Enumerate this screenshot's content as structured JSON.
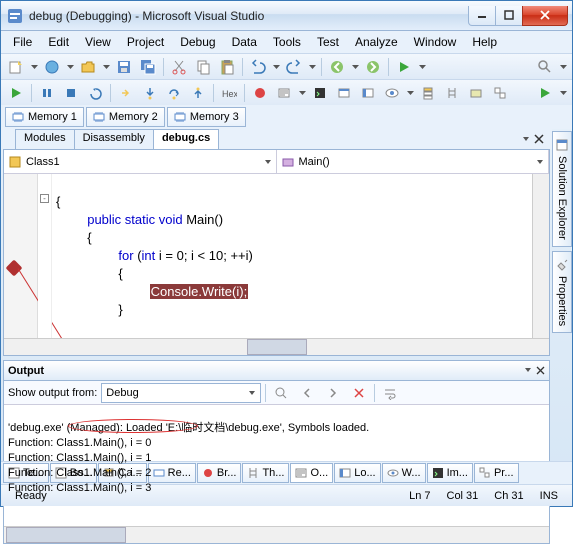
{
  "window": {
    "title": "debug (Debugging) - Microsoft Visual Studio"
  },
  "menu": [
    "File",
    "Edit",
    "View",
    "Project",
    "Debug",
    "Data",
    "Tools",
    "Test",
    "Analyze",
    "Window",
    "Help"
  ],
  "memory_tabs": [
    "Memory 1",
    "Memory 2",
    "Memory 3"
  ],
  "doc_tabs": [
    {
      "label": "Modules",
      "active": false
    },
    {
      "label": "Disassembly",
      "active": false
    },
    {
      "label": "debug.cs",
      "active": true
    }
  ],
  "nav": {
    "left": "Class1",
    "right": "Main()"
  },
  "code": {
    "l1": "{",
    "l2": "public static void Main()",
    "l2kw": "public static void",
    "l2rest": " Main()",
    "l3": "{",
    "l4a": "for",
    "l4b": " (",
    "l4c": "int",
    "l4d": " i = 0; i < 10; ++i)",
    "l5": "{",
    "l6": "Console.Write(i);",
    "l7": "}"
  },
  "output": {
    "title": "Output",
    "show_from_label": "Show output from:",
    "source": "Debug",
    "lines": [
      "'debug.exe' (Managed): Loaded 'E:\\临时文档\\debug.exe', Symbols loaded.",
      "Function: Class1.Main(), i = 0",
      "Function: Class1.Main(), i = 1",
      "Function: Class1.Main(), i = 2",
      "Function: Class1.Main(), i = 3"
    ]
  },
  "side_tabs": [
    "Solution Explorer",
    "Properties"
  ],
  "bottom_tabs": [
    "Te...",
    "Bo...",
    "Ca...",
    "Re...",
    "Br...",
    "Th...",
    "O...",
    "Lo...",
    "W...",
    "Im...",
    "Pr..."
  ],
  "bottom_active": 6,
  "status": {
    "ready": "Ready",
    "ln": "Ln 7",
    "col": "Col 31",
    "ch": "Ch 31",
    "ins": "INS"
  }
}
